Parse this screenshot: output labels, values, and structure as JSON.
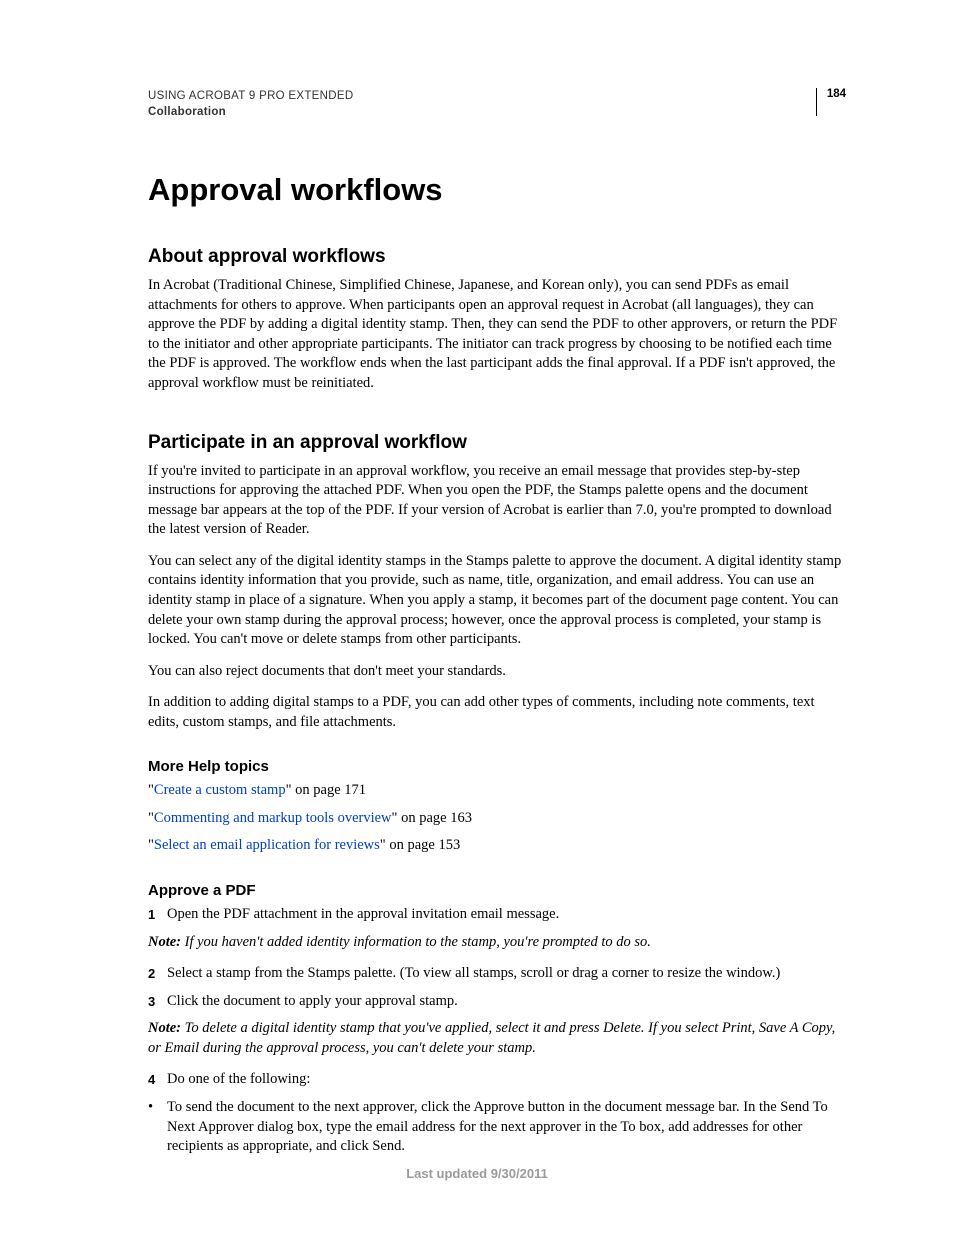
{
  "header": {
    "doc_title": "USING ACROBAT 9 PRO EXTENDED",
    "section": "Collaboration",
    "page_number": "184"
  },
  "title": "Approval workflows",
  "sections": {
    "about": {
      "heading": "About approval workflows",
      "p1": "In Acrobat (Traditional Chinese, Simplified Chinese, Japanese, and Korean only), you can send PDFs as email attachments for others to approve. When participants open an approval request in Acrobat (all languages), they can approve the PDF by adding a digital identity stamp. Then, they can send the PDF to other approvers, or return the PDF to the initiator and other appropriate participants. The initiator can track progress by choosing to be notified each time the PDF is approved. The workflow ends when the last participant adds the final approval. If a PDF isn't approved, the approval workflow must be reinitiated."
    },
    "participate": {
      "heading": "Participate in an approval workflow",
      "p1": "If you're invited to participate in an approval workflow, you receive an email message that provides step-by-step instructions for approving the attached PDF. When you open the PDF, the Stamps palette opens and the document message bar appears at the top of the PDF. If your version of Acrobat is earlier than 7.0, you're prompted to download the latest version of Reader.",
      "p2": "You can select any of the digital identity stamps in the Stamps palette to approve the document. A digital identity stamp contains identity information that you provide, such as name, title, organization, and email address. You can use an identity stamp in place of a signature. When you apply a stamp, it becomes part of the document page content. You can delete your own stamp during the approval process; however, once the approval process is completed, your stamp is locked. You can't move or delete stamps from other participants.",
      "p3": "You can also reject documents that don't meet your standards.",
      "p4": "In addition to adding digital stamps to a PDF, you can add other types of comments, including note comments, text edits, custom stamps, and file attachments."
    },
    "morehelp": {
      "heading": "More Help topics",
      "links": [
        {
          "text": "Create a custom stamp",
          "suffix": "\" on page 171"
        },
        {
          "text": "Commenting and markup tools overview",
          "suffix": "\" on page 163"
        },
        {
          "text": "Select an email application for reviews",
          "suffix": "\" on page 153"
        }
      ]
    },
    "approve": {
      "heading": "Approve a PDF",
      "step1": "Open the PDF attachment in the approval invitation email message.",
      "note1_label": "Note:",
      "note1_text": " If you haven't added identity information to the stamp, you're prompted to do so.",
      "step2": "Select a stamp from the Stamps palette. (To view all stamps, scroll or drag a corner to resize the window.)",
      "step3": "Click the document to apply your approval stamp.",
      "note2_label": "Note:",
      "note2_text": " To delete a digital identity stamp that you've applied, select it and press Delete. If you select Print, Save A Copy, or Email during the approval process, you can't delete your stamp.",
      "step4": "Do one of the following:",
      "bullet1": "To send the document to the next approver, click the Approve button in the document message bar. In the Send To Next Approver dialog box, type the email address for the next approver in the To box, add addresses for other recipients as appropriate, and click Send."
    }
  },
  "nums": {
    "n1": "1",
    "n2": "2",
    "n3": "3",
    "n4": "4"
  },
  "bullet": "•",
  "open_quote": "\"",
  "footer": "Last updated 9/30/2011"
}
